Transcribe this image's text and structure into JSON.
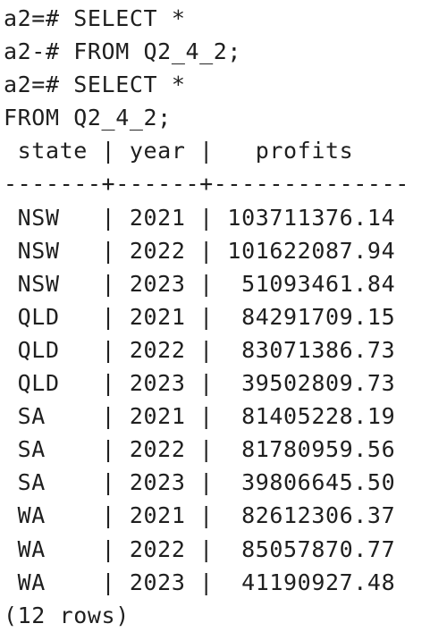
{
  "terminal": {
    "commands": [
      "a2=# SELECT *",
      "a2-# FROM Q2_4_2;",
      "a2=# SELECT *",
      "FROM Q2_4_2;"
    ],
    "header": " state | year |   profits",
    "separator": "-------+------+--------------",
    "rows": [
      " NSW   | 2021 | 103711376.14",
      " NSW   | 2022 | 101622087.94",
      " NSW   | 2023 |  51093461.84",
      " QLD   | 2021 |  84291709.15",
      " QLD   | 2022 |  83071386.73",
      " QLD   | 2023 |  39502809.73",
      " SA    | 2021 |  81405228.19",
      " SA    | 2022 |  81780959.56",
      " SA    | 2023 |  39806645.50",
      " WA    | 2021 |  82612306.37",
      " WA    | 2022 |  85057870.77",
      " WA    | 2023 |  41190927.48"
    ],
    "footer": "(12 rows)"
  }
}
